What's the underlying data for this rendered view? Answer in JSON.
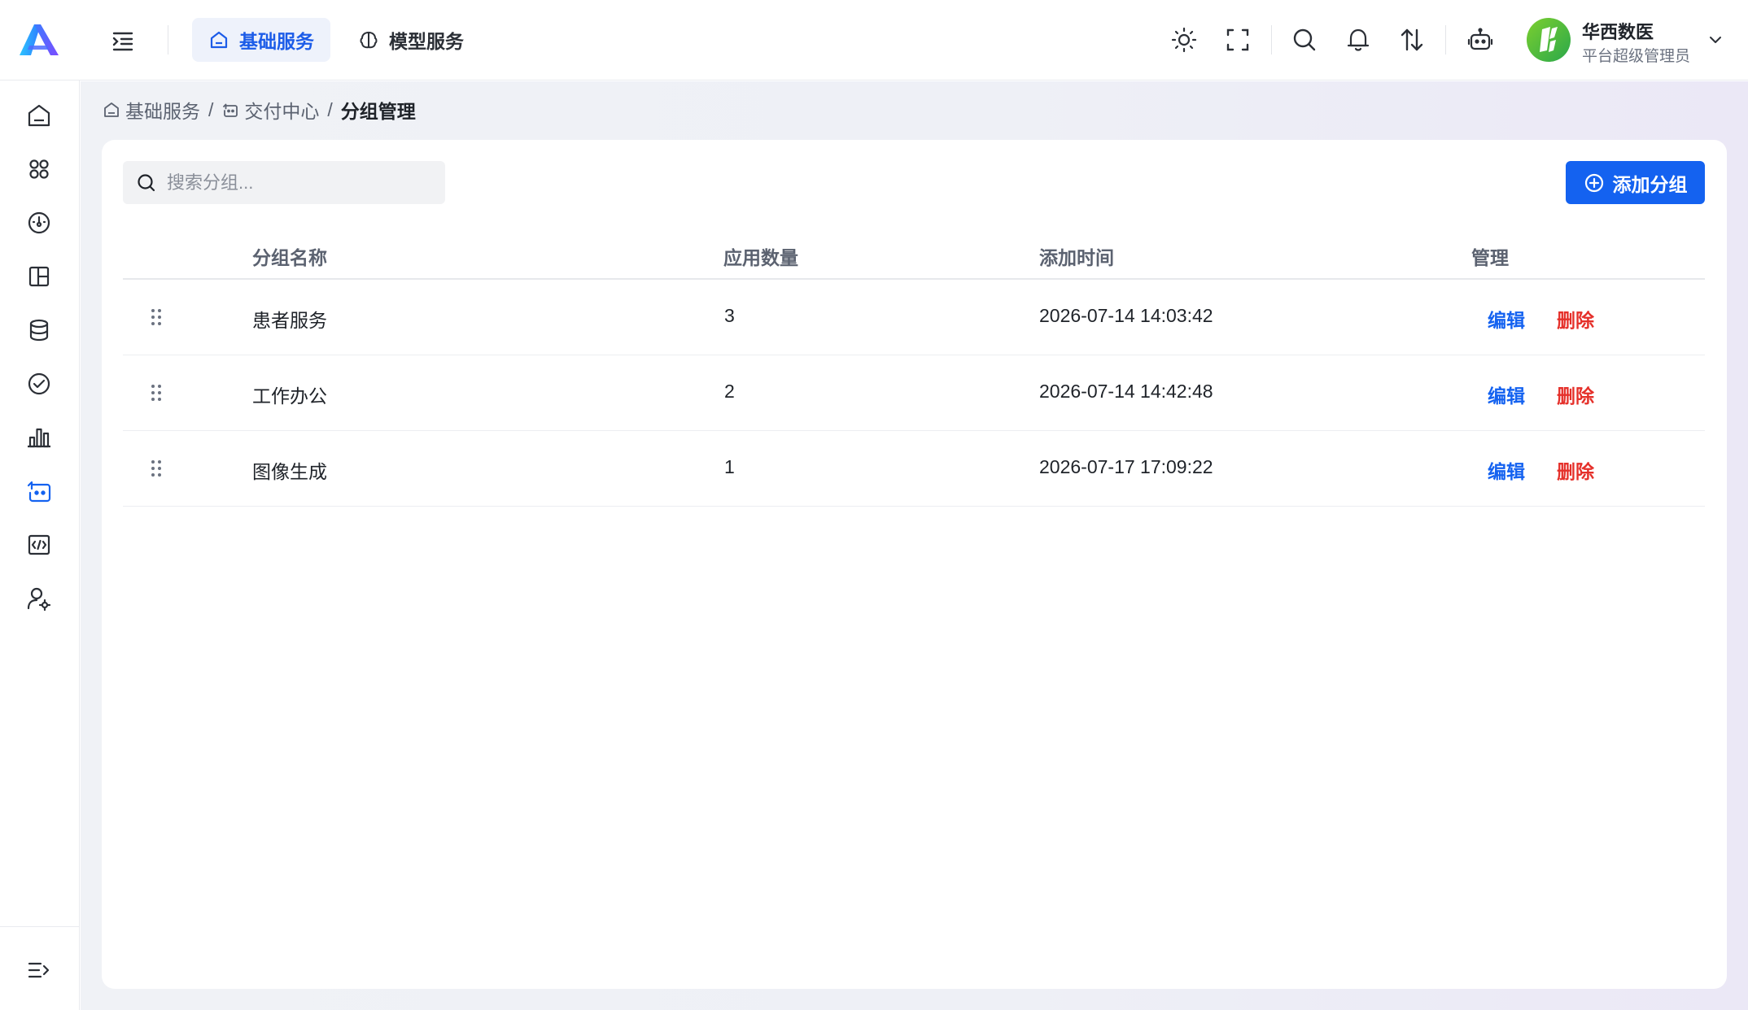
{
  "colors": {
    "accent": "#1462f0",
    "danger": "#e5302a",
    "active_tab_bg": "#eef2fb"
  },
  "header": {
    "collapse_icon": "indent-icon",
    "tabs": [
      {
        "label": "基础服务",
        "icon": "home-icon",
        "active": true
      },
      {
        "label": "模型服务",
        "icon": "brain-icon",
        "active": false
      }
    ],
    "tools": [
      "sun-icon",
      "fullscreen-icon",
      "search-icon",
      "bell-icon",
      "sort-icon",
      "robot-icon"
    ],
    "user": {
      "name": "华西数医",
      "role": "平台超级管理员"
    }
  },
  "sidebar": {
    "items": [
      {
        "icon": "home-icon",
        "active": false
      },
      {
        "icon": "apps-icon",
        "active": false
      },
      {
        "icon": "dashboard-icon",
        "active": false
      },
      {
        "icon": "layout-icon",
        "active": false
      },
      {
        "icon": "database-icon",
        "active": false
      },
      {
        "icon": "check-circle-icon",
        "active": false
      },
      {
        "icon": "bar-chart-icon",
        "active": false
      },
      {
        "icon": "delivery-icon",
        "active": true
      },
      {
        "icon": "code-icon",
        "active": false
      },
      {
        "icon": "user-settings-icon",
        "active": false
      }
    ],
    "footer_icon": "expand-menu-icon"
  },
  "breadcrumb": {
    "items": [
      "基础服务",
      "交付中心",
      "分组管理"
    ],
    "separator": "/"
  },
  "toolbar": {
    "search_placeholder": "搜索分组...",
    "add_label": "添加分组"
  },
  "table": {
    "columns": [
      "分组名称",
      "应用数量",
      "添加时间",
      "管理"
    ],
    "rows": [
      {
        "name": "患者服务",
        "count": "3",
        "time": "2026-07-14 14:03:42"
      },
      {
        "name": "工作办公",
        "count": "2",
        "time": "2026-07-14 14:42:48"
      },
      {
        "name": "图像生成",
        "count": "1",
        "time": "2026-07-17 17:09:22"
      }
    ],
    "actions": {
      "edit": "编辑",
      "delete": "删除"
    }
  }
}
